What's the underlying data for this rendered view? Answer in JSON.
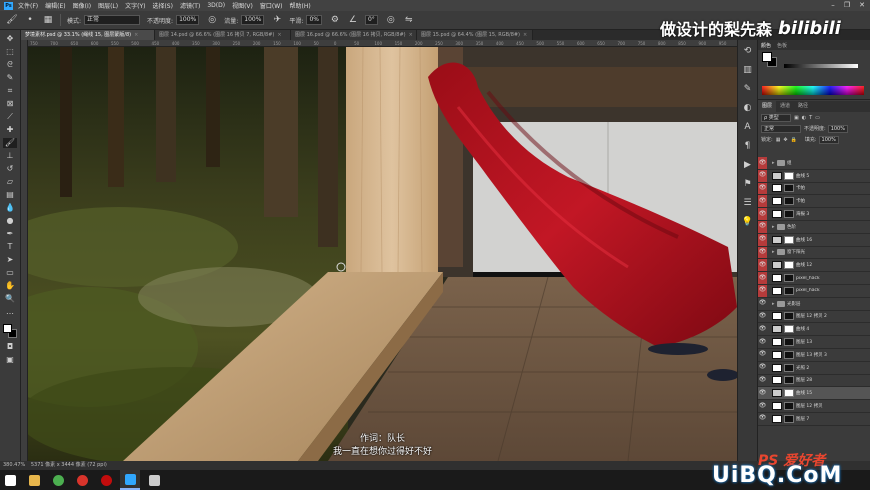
{
  "menubar": {
    "app_icon": "Ps",
    "items": [
      "文件(F)",
      "编辑(E)",
      "图像(I)",
      "图层(L)",
      "文字(Y)",
      "选择(S)",
      "滤镜(T)",
      "3D(D)",
      "视图(V)",
      "窗口(W)",
      "帮助(H)"
    ],
    "window_controls": [
      "minimize-icon",
      "restore-icon",
      "close-icon"
    ]
  },
  "options": {
    "tool_icon": "brush-icon",
    "mode_label": "模式:",
    "mode_value": "正常",
    "opacity_label": "不透明度:",
    "opacity_value": "100%",
    "flow_label": "流量:",
    "flow_value": "100%",
    "smoothing_label": "平滑:",
    "smoothing_value": "0%",
    "angle_value": "0°"
  },
  "doc_tabs": [
    {
      "label": "梦境素材.psd @ 33.1% (绳线 15, 图层蒙版/8)",
      "active": true
    },
    {
      "label": "图层 14.psd @ 66.6% (图层 16 拷贝 7, RGB/8#)",
      "active": false
    },
    {
      "label": "图层 16.psd @ 66.6% (图层 16 拷贝, RGB/8#)",
      "active": false
    },
    {
      "label": "图层 15.psd @ 64.4% (图层 15, RGB/8#)",
      "active": false
    }
  ],
  "ruler_ticks": [
    "750",
    "700",
    "650",
    "600",
    "550",
    "500",
    "450",
    "400",
    "350",
    "300",
    "250",
    "200",
    "150",
    "100",
    "50",
    "0",
    "50",
    "100",
    "150",
    "200",
    "250",
    "300",
    "350",
    "400",
    "450",
    "500",
    "550",
    "600",
    "650",
    "700",
    "750",
    "800",
    "850",
    "900",
    "950"
  ],
  "watermark": {
    "text": "做设计的梨先森",
    "brand": "bilibili"
  },
  "subtitles": {
    "line1": "作词：队长",
    "line2": "我一直在想你过得好不好"
  },
  "color_panel": {
    "tabs": [
      "颜色",
      "色板"
    ],
    "foreground": "#ffffff",
    "background": "#000000"
  },
  "layers_panel": {
    "tabs": [
      "图层",
      "通道",
      "路径"
    ],
    "filter_label": "ρ 类型",
    "blend_mode": "正常",
    "opacity_label": "不透明度:",
    "opacity_value": "100%",
    "lock_label": "锁定:",
    "fill_label": "填充:",
    "fill_value": "100%",
    "layers": [
      {
        "name": "组",
        "type": "group",
        "red": true
      },
      {
        "name": "曲线 5",
        "type": "adj",
        "red": true
      },
      {
        "name": "卡帕",
        "type": "layer",
        "red": true
      },
      {
        "name": "卡帕",
        "type": "layer",
        "red": true
      },
      {
        "name": "海报 3",
        "type": "layer",
        "red": true
      },
      {
        "name": "色阶",
        "type": "group",
        "red": true
      },
      {
        "name": "曲线 16",
        "type": "adj",
        "red": true
      },
      {
        "name": "窗下阳光",
        "type": "group",
        "red": true
      },
      {
        "name": "曲线 12",
        "type": "adj",
        "red": true
      },
      {
        "name": "pixel_hack",
        "type": "layer",
        "red": true
      },
      {
        "name": "pixel_hack",
        "type": "layer",
        "red": true
      },
      {
        "name": "光影层",
        "type": "group",
        "red": false
      },
      {
        "name": "图层 12 拷贝 2",
        "type": "layer",
        "red": false
      },
      {
        "name": "曲线 4",
        "type": "adj",
        "red": false
      },
      {
        "name": "图层 13",
        "type": "layer",
        "red": false
      },
      {
        "name": "图层 13 拷贝 3",
        "type": "layer",
        "red": false
      },
      {
        "name": "光照 2",
        "type": "layer",
        "red": false
      },
      {
        "name": "图层 28",
        "type": "layer",
        "red": false
      },
      {
        "name": "曲线 15",
        "type": "adj",
        "red": false,
        "selected": true
      },
      {
        "name": "图层 12 拷贝",
        "type": "layer",
        "red": false
      },
      {
        "name": "图层 7",
        "type": "layer",
        "red": false
      }
    ]
  },
  "status": {
    "zoom": "380.47%",
    "doc_size": "5371 像素 x 3444 像素 (72 ppi)"
  },
  "site_watermark": {
    "ps_text": "PS 爱好者",
    "domain": "UiBQ.CoM"
  },
  "taskbar_icons": [
    {
      "name": "start-icon",
      "color": "#ffffff"
    },
    {
      "name": "file-explorer-icon",
      "color": "#e8b64c"
    },
    {
      "name": "chrome-icon",
      "color": "#4caf50"
    },
    {
      "name": "app-red-icon",
      "color": "#d9342b"
    },
    {
      "name": "netease-icon",
      "color": "#c20c0c"
    },
    {
      "name": "photoshop-icon",
      "color": "#31a8ff"
    },
    {
      "name": "notes-icon",
      "color": "#cccccc"
    }
  ]
}
